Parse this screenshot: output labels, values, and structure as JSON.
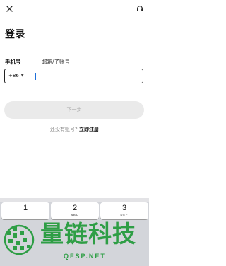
{
  "header": {
    "close_icon": "close-icon",
    "support_icon": "headset-icon"
  },
  "title": "登录",
  "tabs": {
    "phone": "手机号",
    "email": "邮箱/子账号"
  },
  "phone_field": {
    "country_code": "+86",
    "value": "",
    "placeholder": ""
  },
  "next_button": "下一步",
  "register": {
    "prompt": "还没有账号?",
    "link": "立即注册"
  },
  "keypad": {
    "keys": [
      {
        "digit": "1",
        "letters": ""
      },
      {
        "digit": "2",
        "letters": "ABC"
      },
      {
        "digit": "3",
        "letters": "DEF"
      }
    ]
  },
  "watermark": {
    "name": "量链科技",
    "url": "QFSP.NET"
  },
  "colors": {
    "accent": "#1e6fd9",
    "disabled_button": "#eaeaea",
    "watermark": "#2e9e45"
  }
}
